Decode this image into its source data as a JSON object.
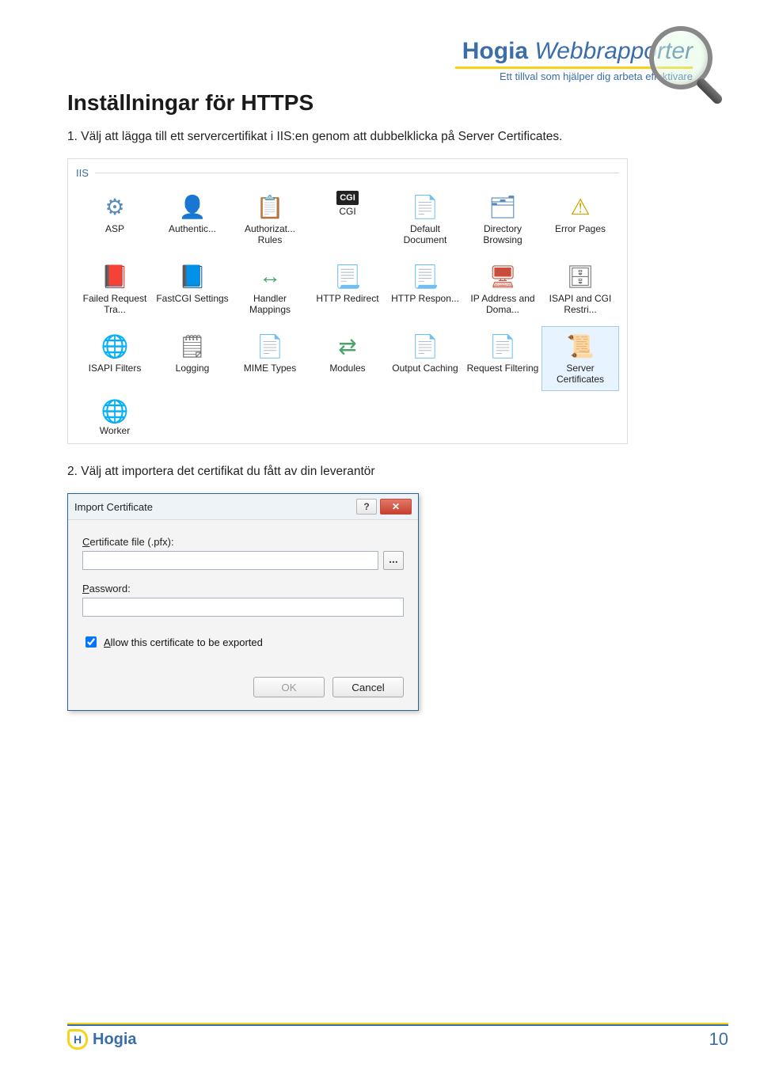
{
  "header": {
    "brand": "Hogia",
    "product": "Webbrapporter",
    "tagline": "Ett tillval som hjälper dig arbeta effektivare"
  },
  "page": {
    "title": "Inställningar för HTTPS",
    "step1": "1. Välj att lägga till ett servercertifikat i IIS:en genom att dubbelklicka på Server Certificates.",
    "step2": "2. Välj att importera det certifikat du fått av din leverantör"
  },
  "iis": {
    "group_label": "IIS",
    "items": [
      {
        "label": "ASP",
        "icon": "⚙",
        "cls": "i-gear"
      },
      {
        "label": "Authentic...",
        "icon": "👤",
        "cls": "i-user"
      },
      {
        "label": "Authorizat... Rules",
        "icon": "📋",
        "cls": "i-list"
      },
      {
        "label": "CGI",
        "icon": "CGI",
        "cls": "i-cgi"
      },
      {
        "label": "Default Document",
        "icon": "📄",
        "cls": "i-doc"
      },
      {
        "label": "Directory Browsing",
        "icon": "🗂",
        "cls": "i-dir"
      },
      {
        "label": "Error Pages",
        "icon": "⚠",
        "cls": "i-404"
      },
      {
        "label": "Failed Request Tra...",
        "icon": "📕",
        "cls": "i-fail"
      },
      {
        "label": "FastCGI Settings",
        "icon": "📘",
        "cls": "i-fast"
      },
      {
        "label": "Handler Mappings",
        "icon": "↔",
        "cls": "i-hand"
      },
      {
        "label": "HTTP Redirect",
        "icon": "📃",
        "cls": "i-http"
      },
      {
        "label": "HTTP Respon...",
        "icon": "📃",
        "cls": "i-resp"
      },
      {
        "label": "IP Address and Doma...",
        "icon": "🖥",
        "cls": "i-ip"
      },
      {
        "label": "ISAPI and CGI Restri...",
        "icon": "🗄",
        "cls": "i-isapi"
      },
      {
        "label": "ISAPI Filters",
        "icon": "🌐",
        "cls": "i-globe"
      },
      {
        "label": "Logging",
        "icon": "🗒",
        "cls": "i-log"
      },
      {
        "label": "MIME Types",
        "icon": "📄",
        "cls": "i-mime"
      },
      {
        "label": "Modules",
        "icon": "⇄",
        "cls": "i-mod"
      },
      {
        "label": "Output Caching",
        "icon": "📄",
        "cls": "i-cache"
      },
      {
        "label": "Request Filtering",
        "icon": "📄",
        "cls": "i-filt"
      },
      {
        "label": "Server Certificates",
        "icon": "📜",
        "cls": "i-cert",
        "selected": true
      }
    ],
    "worker": {
      "label": "Worker",
      "icon": "🌐",
      "cls": "i-work"
    }
  },
  "dialog": {
    "title": "Import Certificate",
    "help": "?",
    "close": "✕",
    "cert_label_prefix": "C",
    "cert_label_rest": "ertificate file (.pfx):",
    "cert_value": "",
    "browse": "...",
    "pwd_label_prefix": "P",
    "pwd_label_rest": "assword:",
    "pwd_value": "",
    "allow_checked": true,
    "allow_label_prefix": "A",
    "allow_label_rest": "llow this certificate to be exported",
    "ok": "OK",
    "cancel": "Cancel"
  },
  "footer": {
    "brand": "Hogia",
    "mark": "H",
    "page_number": "10"
  }
}
